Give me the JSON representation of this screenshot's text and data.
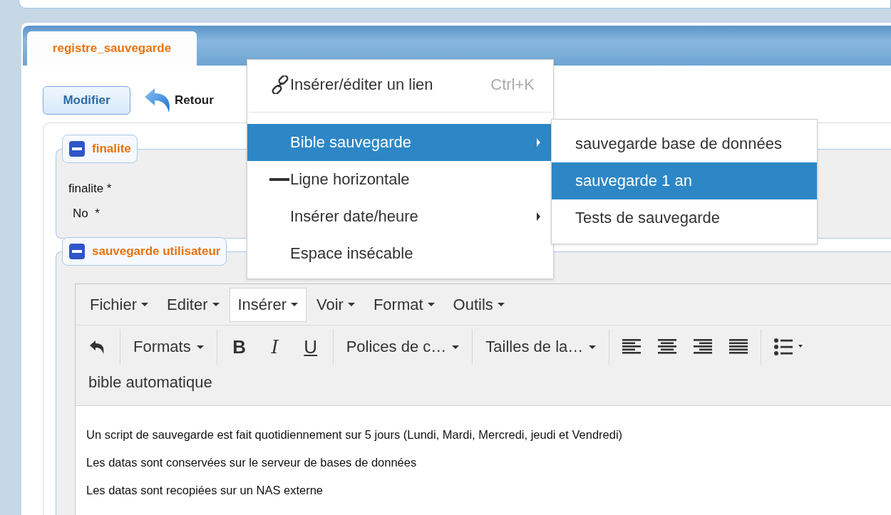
{
  "panel": {
    "tab": {
      "label": "registre_sauvegarde",
      "selected": true
    }
  },
  "actions": {
    "edit_button": "Modifier",
    "back_link": "Retour"
  },
  "fieldsets": [
    {
      "legend": "finalite",
      "expanded": true,
      "lines": [
        "finalite *",
        "No  *"
      ]
    },
    {
      "legend": "sauvegarde utilisateur",
      "expanded": true
    }
  ],
  "editor": {
    "menubar": [
      {
        "label": "Fichier",
        "selected": false
      },
      {
        "label": "Editer",
        "selected": false
      },
      {
        "label": "Insérer",
        "selected": true
      },
      {
        "label": "Voir",
        "selected": false
      },
      {
        "label": "Format",
        "selected": false
      },
      {
        "label": "Outils",
        "selected": false
      }
    ],
    "toolbar": [
      {
        "kind": "undo"
      },
      {
        "kind": "sep"
      },
      {
        "kind": "dropdown",
        "label": "Formats"
      },
      {
        "kind": "sep"
      },
      {
        "kind": "bold",
        "label": "B"
      },
      {
        "kind": "italic",
        "label": "I"
      },
      {
        "kind": "underline",
        "label": "U"
      },
      {
        "kind": "sep"
      },
      {
        "kind": "dropdown",
        "label": "Polices de c…"
      },
      {
        "kind": "sep"
      },
      {
        "kind": "dropdown",
        "label": "Tailles de la…"
      },
      {
        "kind": "sep"
      },
      {
        "kind": "alignleft"
      },
      {
        "kind": "aligncenter"
      },
      {
        "kind": "alignright"
      },
      {
        "kind": "justify"
      },
      {
        "kind": "sep"
      },
      {
        "kind": "list"
      }
    ],
    "extra_button": "bible automatique",
    "paragraphs": [
      "Un script de sauvegarde est fait quotidiennement sur 5 jours (Lundi, Mardi, Mercredi, jeudi et Vendredi)",
      "Les datas sont conservées sur le serveur de bases de données",
      "Les datas sont recopiées sur un NAS externe"
    ]
  },
  "insert_menu": [
    {
      "kind": "link",
      "label": "Insérer/éditer un lien",
      "shortcut": "Ctrl+K",
      "selected": false
    },
    {
      "kind": "separator"
    },
    {
      "kind": "submenu",
      "label": "Bible sauvegarde",
      "selected": true
    },
    {
      "kind": "rule",
      "label": "Ligne horizontale",
      "selected": false
    },
    {
      "kind": "submenu",
      "label": "Insérer date/heure",
      "selected": false
    },
    {
      "kind": "plain",
      "label": "Espace insécable",
      "selected": false
    }
  ],
  "submenu": [
    {
      "label": "sauvegarde base de données",
      "selected": false
    },
    {
      "label": "sauvegarde 1 an",
      "selected": true
    },
    {
      "label": "Tests de sauvegarde",
      "selected": false
    }
  ]
}
